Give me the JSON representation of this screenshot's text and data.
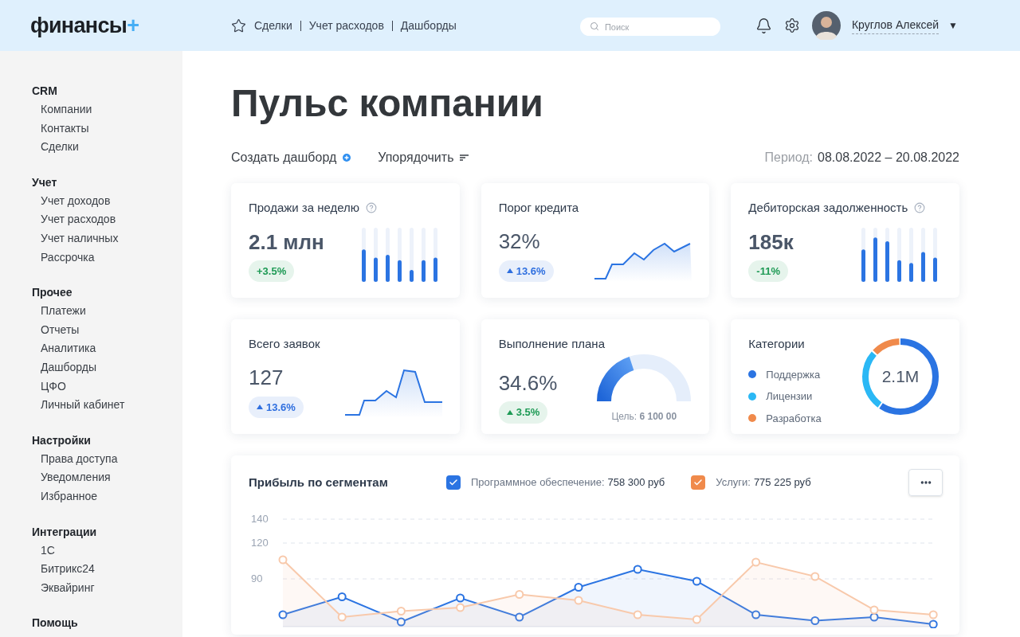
{
  "header": {
    "logo": {
      "text": "финансы",
      "mark": "+"
    },
    "nav": [
      {
        "label": "Сделки"
      },
      {
        "label": "Учет расходов"
      },
      {
        "label": "Дашборды"
      }
    ],
    "search": {
      "placeholder": "Поиск"
    },
    "user": {
      "name": "Круглов Алексей",
      "caret": "▼"
    }
  },
  "sidebar": {
    "sections": [
      {
        "title": "CRM",
        "items": [
          "Компании",
          "Контакты",
          "Сделки"
        ]
      },
      {
        "title": "Учет",
        "items": [
          "Учет доходов",
          "Учет расходов",
          "Учет наличных",
          "Рассрочка"
        ]
      },
      {
        "title": "Прочее",
        "items": [
          "Платежи",
          "Отчеты",
          "Аналитика",
          "Дашборды",
          "ЦФО",
          "Личный кабинет"
        ]
      },
      {
        "title": "Настройки",
        "items": [
          "Права доступа",
          "Уведомления",
          "Избранное"
        ]
      },
      {
        "title": "Интеграции",
        "items": [
          "1С",
          "Битрикс24",
          "Эквайринг"
        ]
      },
      {
        "title": "Помощь"
      }
    ]
  },
  "page": {
    "title": "Пульс компании",
    "actions": [
      {
        "label": "Создать дашборд",
        "kind": "create"
      },
      {
        "label": "Упорядочить",
        "kind": "sort"
      }
    ],
    "period": {
      "label": "Период:",
      "value": "08.08.2022 – 20.08.2022"
    }
  },
  "cards": [
    {
      "kind": "bars",
      "title": "Продажи за неделю",
      "help": true,
      "value": "2.1 млн",
      "badge": {
        "text": "+3.5%",
        "color": "#1e9a55",
        "arrow": false
      }
    },
    {
      "kind": "line",
      "title": "Порог кредита",
      "help": false,
      "value": "32%",
      "badge": {
        "text": "13.6%",
        "color": "#2f6fdf",
        "arrow": true
      }
    },
    {
      "kind": "bars",
      "title": "Дебиторская задолженность",
      "help": true,
      "value": "185к",
      "badge": {
        "text": "-11%",
        "color": "#1e9a55",
        "arrow": false
      }
    },
    {
      "kind": "line",
      "title": "Всего заявок",
      "help": false,
      "value": "127",
      "badge": {
        "text": "13.6%",
        "color": "#2f6fdf",
        "arrow": true
      }
    },
    {
      "kind": "gauge",
      "title": "Выполнение плана",
      "help": false,
      "value": "34.6%",
      "badge": {
        "text": "3.5%",
        "color": "#1e9a55",
        "arrow": true
      },
      "level": 0.4,
      "goal": "Цель: **6 100 00**"
    },
    {
      "kind": "donut",
      "title": "Категории",
      "center": "2.1M",
      "legend": [
        {
          "label": "Поддержка",
          "color": "#2b74e2"
        },
        {
          "label": "Лицензии",
          "color": "#2bb8f5"
        },
        {
          "label": "Разработка",
          "color": "#f08a4b"
        }
      ]
    }
  ],
  "profit": {
    "title": "Прибыль по сегментам",
    "legend": [
      {
        "label": "Программное обеспечение:",
        "value": "758 300 руб",
        "checked": true,
        "color": "#2b74e2"
      },
      {
        "label": "Услуги:",
        "value": "775 225 руб",
        "checked": true,
        "color": "#f08a4b"
      }
    ],
    "chart_data": {
      "type": "area",
      "grid": true,
      "ylim": [
        50,
        140
      ],
      "yticks": [
        140,
        120,
        90
      ],
      "series": [
        {
          "color": "#2b74e2",
          "marker": "circle",
          "values": [
            60,
            75,
            54,
            74,
            58,
            83,
            98,
            88,
            60,
            55,
            58,
            52
          ]
        },
        {
          "color": "#f8c9ab",
          "marker": "circle",
          "values": [
            106,
            58,
            63,
            66,
            77,
            72,
            60,
            56,
            104,
            92,
            64,
            60
          ]
        }
      ]
    }
  }
}
